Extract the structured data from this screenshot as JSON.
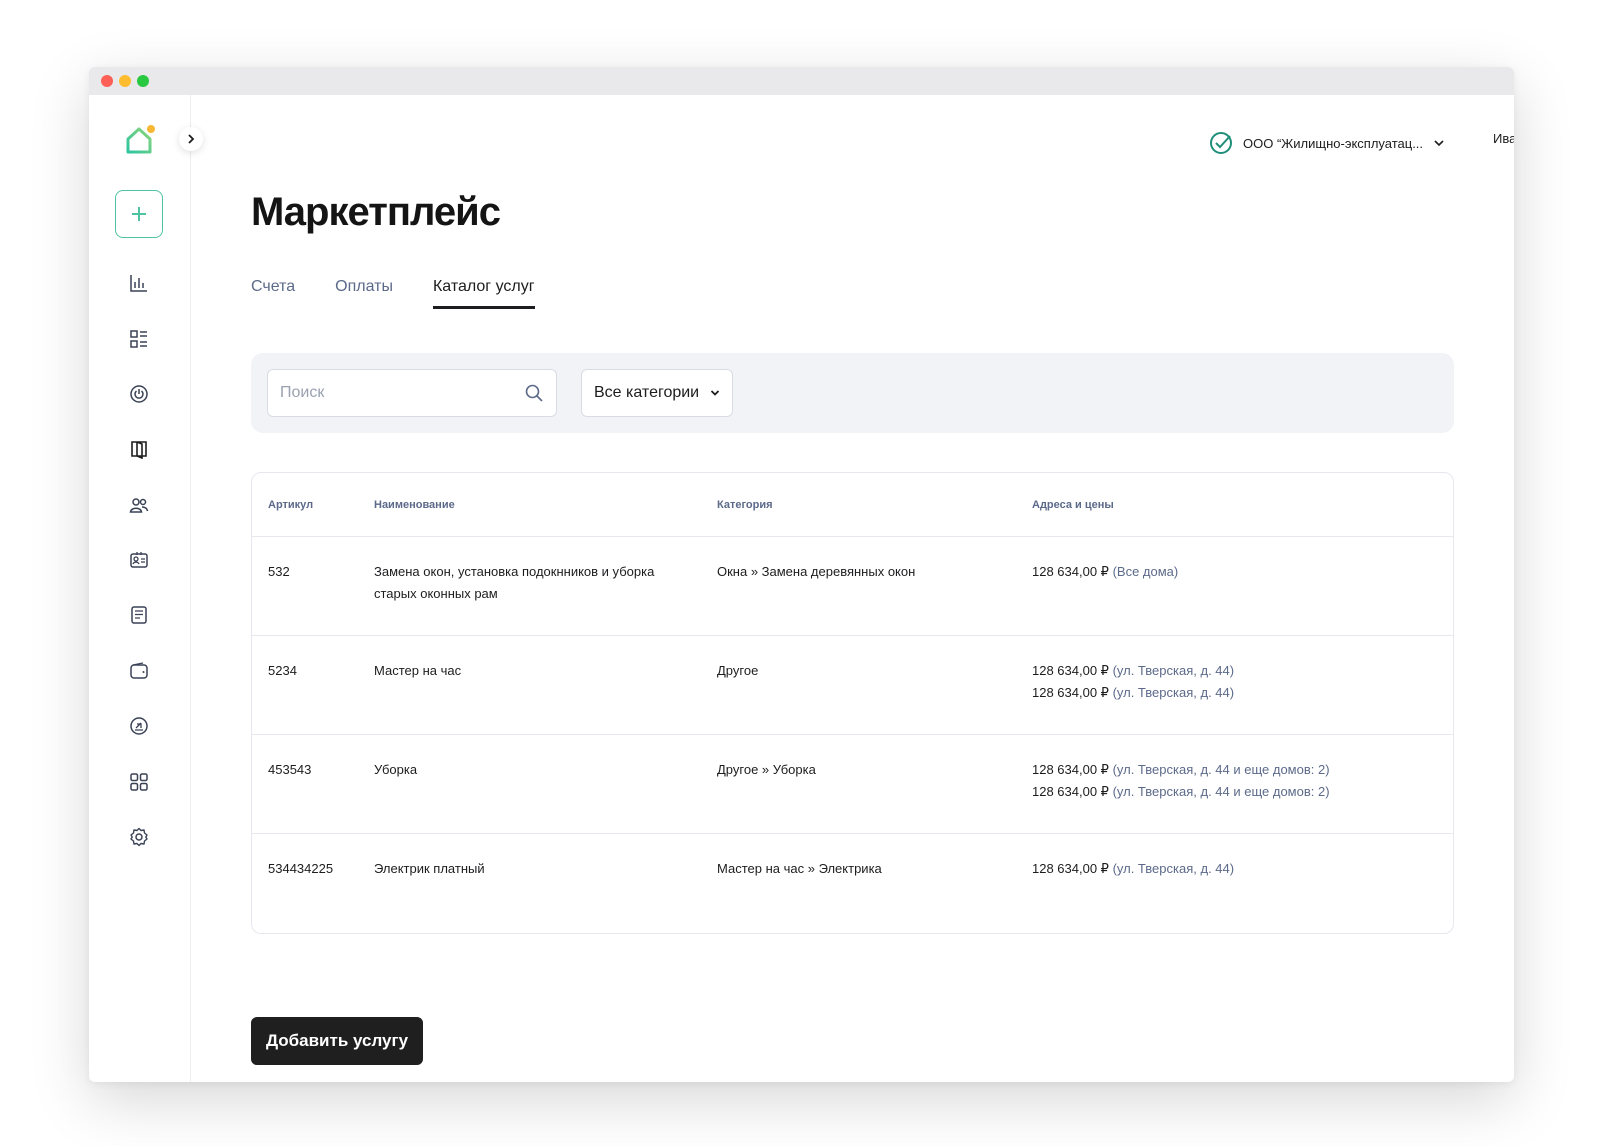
{
  "window": {
    "controls": [
      "close",
      "minimize",
      "maximize"
    ]
  },
  "sidebar": {
    "logo": "home-logo-icon",
    "items": [
      {
        "icon": "add-icon"
      },
      {
        "icon": "bar-chart-icon"
      },
      {
        "icon": "dashboard-list-icon"
      },
      {
        "icon": "power-icon"
      },
      {
        "icon": "book-icon"
      },
      {
        "icon": "users-icon"
      },
      {
        "icon": "id-card-icon"
      },
      {
        "icon": "document-icon"
      },
      {
        "icon": "wallet-icon"
      },
      {
        "icon": "payment-icon"
      },
      {
        "icon": "apps-grid-icon"
      },
      {
        "icon": "settings-icon"
      }
    ]
  },
  "header": {
    "org_name": "ООО “Жилищно-эксплуатац...",
    "user_name": "Иван"
  },
  "page": {
    "title": "Маркетплейс",
    "tabs": [
      {
        "label": "Счета",
        "active": false
      },
      {
        "label": "Оплаты",
        "active": false
      },
      {
        "label": "Каталог услуг",
        "active": true
      }
    ]
  },
  "filters": {
    "search_placeholder": "Поиск",
    "category_value": "Все категории"
  },
  "table": {
    "columns": [
      "Артикул",
      "Наименование",
      "Категория",
      "Адреса и цены"
    ],
    "rows": [
      {
        "sku": "532",
        "name": "Замена окон, установка подокнников и уборка старых оконных рам",
        "category": "Окна » Замена деревянных окон",
        "prices": [
          {
            "price": "128 634,00 ₽",
            "address": "(Все дома)"
          }
        ]
      },
      {
        "sku": "5234",
        "name": "Мастер на час",
        "category": "Другое",
        "prices": [
          {
            "price": "128 634,00 ₽",
            "address": "(ул. Тверская, д. 44)"
          },
          {
            "price": "128 634,00 ₽",
            "address": "(ул. Тверская, д. 44)"
          }
        ]
      },
      {
        "sku": "453543",
        "name": "Уборка",
        "category": "Другое » Уборка",
        "prices": [
          {
            "price": "128 634,00 ₽",
            "address": "(ул. Тверская, д. 44 и еще домов: 2)"
          },
          {
            "price": "128 634,00 ₽",
            "address": "(ул. Тверская, д. 44 и еще домов: 2)"
          }
        ]
      },
      {
        "sku": "534434225",
        "name": "Электрик платный",
        "category": "Мастер на час » Электрика",
        "prices": [
          {
            "price": "128 634,00 ₽",
            "address": "(ул. Тверская, д. 44)"
          }
        ]
      }
    ]
  },
  "actions": {
    "add_service_label": "Добавить услугу"
  },
  "colors": {
    "accent": "#4fc3a1",
    "muted_text": "#5c6a8a",
    "primary_button": "#1f1f1f",
    "filter_bg": "#f2f3f7"
  }
}
